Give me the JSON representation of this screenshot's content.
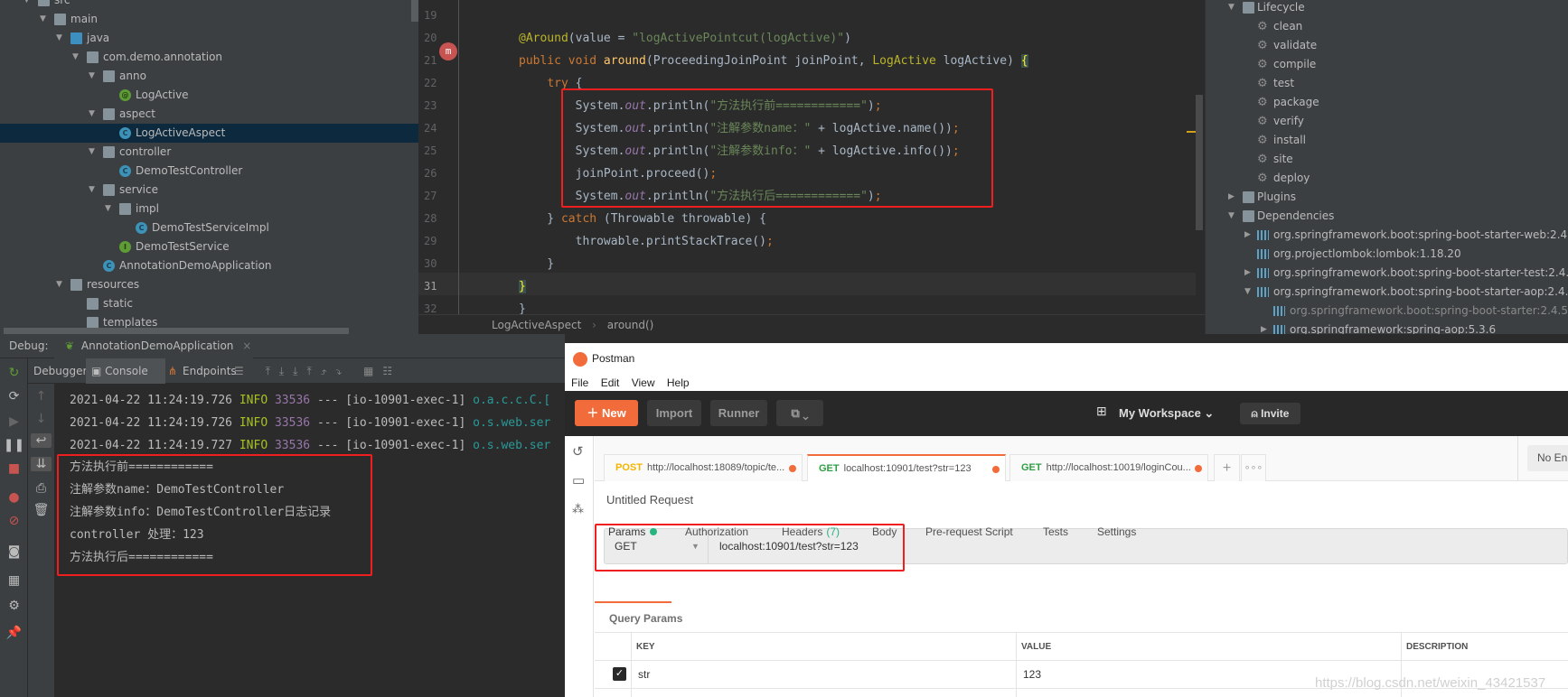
{
  "project_tree": [
    {
      "label": "src",
      "depth": 1,
      "icon": "folder",
      "expanded": true
    },
    {
      "label": "main",
      "depth": 2,
      "icon": "folder",
      "expanded": true
    },
    {
      "label": "java",
      "depth": 3,
      "icon": "source-folder",
      "expanded": true
    },
    {
      "label": "com.demo.annotation",
      "depth": 4,
      "icon": "package",
      "expanded": true
    },
    {
      "label": "anno",
      "depth": 5,
      "icon": "package",
      "expanded": true
    },
    {
      "label": "LogActive",
      "depth": 6,
      "icon": "annotation",
      "glyph": "@"
    },
    {
      "label": "aspect",
      "depth": 5,
      "icon": "package",
      "expanded": true
    },
    {
      "label": "LogActiveAspect",
      "depth": 6,
      "icon": "class",
      "glyph": "C",
      "selected": true
    },
    {
      "label": "controller",
      "depth": 5,
      "icon": "package",
      "expanded": true
    },
    {
      "label": "DemoTestController",
      "depth": 6,
      "icon": "class",
      "glyph": "C"
    },
    {
      "label": "service",
      "depth": 5,
      "icon": "package",
      "expanded": true
    },
    {
      "label": "impl",
      "depth": 6,
      "icon": "package",
      "expanded": true
    },
    {
      "label": "DemoTestServiceImpl",
      "depth": 7,
      "icon": "class",
      "glyph": "C"
    },
    {
      "label": "DemoTestService",
      "depth": 6,
      "icon": "interface",
      "glyph": "I"
    },
    {
      "label": "AnnotationDemoApplication",
      "depth": 5,
      "icon": "spring-boot-class",
      "glyph": "C"
    },
    {
      "label": "resources",
      "depth": 3,
      "icon": "resources-folder",
      "expanded": true
    },
    {
      "label": "static",
      "depth": 4,
      "icon": "folder"
    },
    {
      "label": "templates",
      "depth": 4,
      "icon": "folder"
    }
  ],
  "editor": {
    "first_line": 19,
    "current_line": 31,
    "lines": [
      [],
      [
        {
          "t": "@Around",
          "c": "an"
        },
        {
          "t": "(value = "
        },
        {
          "t": "\"logActivePointcut(logActive)\"",
          "c": "st"
        },
        {
          "t": ")"
        }
      ],
      [
        {
          "t": "public void ",
          "c": "kw"
        },
        {
          "t": "around",
          "c": "mt"
        },
        {
          "t": "(ProceedingJoinPoint joinPoint, "
        },
        {
          "t": "LogActive",
          "c": "tp"
        },
        {
          "t": " logActive) "
        },
        {
          "t": "{",
          "c": "br"
        }
      ],
      [
        {
          "t": "    "
        },
        {
          "t": "try",
          "c": "kw"
        },
        {
          "t": " {"
        }
      ],
      [
        {
          "t": "        System."
        },
        {
          "t": "out",
          "c": "fd"
        },
        {
          "t": ".println("
        },
        {
          "t": "\"方法执行前============\"",
          "c": "st"
        },
        {
          "t": ")"
        },
        {
          "t": ";",
          "c": "kw"
        }
      ],
      [
        {
          "t": "        System."
        },
        {
          "t": "out",
          "c": "fd"
        },
        {
          "t": ".println("
        },
        {
          "t": "\"注解参数name：\"",
          "c": "st"
        },
        {
          "t": " + logActive.name())"
        },
        {
          "t": ";",
          "c": "kw"
        }
      ],
      [
        {
          "t": "        System."
        },
        {
          "t": "out",
          "c": "fd"
        },
        {
          "t": ".println("
        },
        {
          "t": "\"注解参数info：\"",
          "c": "st"
        },
        {
          "t": " + logActive.info())"
        },
        {
          "t": ";",
          "c": "kw"
        }
      ],
      [
        {
          "t": "        joinPoint.proceed()"
        },
        {
          "t": ";",
          "c": "kw"
        }
      ],
      [
        {
          "t": "        System."
        },
        {
          "t": "out",
          "c": "fd"
        },
        {
          "t": ".println("
        },
        {
          "t": "\"方法执行后============\"",
          "c": "st"
        },
        {
          "t": ")"
        },
        {
          "t": ";",
          "c": "kw"
        }
      ],
      [
        {
          "t": "    } "
        },
        {
          "t": "catch",
          "c": "kw"
        },
        {
          "t": " (Throwable throwable) {"
        }
      ],
      [
        {
          "t": "        throwable.printStackTrace()"
        },
        {
          "t": ";",
          "c": "kw"
        }
      ],
      [
        {
          "t": "    }"
        }
      ],
      [
        {
          "t": "}",
          "c": "br"
        }
      ],
      [
        {
          "t": "}"
        }
      ]
    ],
    "breadcrumb": [
      "LogActiveAspect",
      "around()"
    ]
  },
  "maven": [
    {
      "label": "Lifecycle",
      "depth": 0,
      "icon": "lifecycle-folder",
      "expanded": true
    },
    {
      "label": "clean",
      "depth": 1,
      "icon": "gear"
    },
    {
      "label": "validate",
      "depth": 1,
      "icon": "gear"
    },
    {
      "label": "compile",
      "depth": 1,
      "icon": "gear"
    },
    {
      "label": "test",
      "depth": 1,
      "icon": "gear"
    },
    {
      "label": "package",
      "depth": 1,
      "icon": "gear"
    },
    {
      "label": "verify",
      "depth": 1,
      "icon": "gear"
    },
    {
      "label": "install",
      "depth": 1,
      "icon": "gear"
    },
    {
      "label": "site",
      "depth": 1,
      "icon": "gear"
    },
    {
      "label": "deploy",
      "depth": 1,
      "icon": "gear"
    },
    {
      "label": "Plugins",
      "depth": 0,
      "icon": "plugins-folder",
      "expanded": false
    },
    {
      "label": "Dependencies",
      "depth": 0,
      "icon": "dependencies-folder",
      "expanded": true
    },
    {
      "label": "org.springframework.boot:spring-boot-starter-web:2.4.5",
      "depth": 1,
      "icon": "library",
      "expanded": false
    },
    {
      "label": "org.projectlombok:lombok:1.18.20",
      "depth": 1,
      "icon": "library"
    },
    {
      "label": "org.springframework.boot:spring-boot-starter-test:2.4.5",
      "depth": 1,
      "icon": "library",
      "expanded": false
    },
    {
      "label": "org.springframework.boot:spring-boot-starter-aop:2.4.5",
      "depth": 1,
      "icon": "library",
      "expanded": true
    },
    {
      "label": "org.springframework.boot:spring-boot-starter:2.4.5 (",
      "depth": 2,
      "icon": "library",
      "dim": true
    },
    {
      "label": "org.springframework:spring-aop:5.3.6",
      "depth": 2,
      "icon": "library",
      "expanded": false
    }
  ],
  "debug": {
    "label": "Debug:",
    "run_config": "AnnotationDemoApplication",
    "tabs": [
      "Debugger",
      "Console",
      "Endpoints"
    ],
    "log_lines": [
      {
        "date": "2021-04-22 11:24:19.726",
        "level": "INFO",
        "pid": "33536",
        "sep": "---",
        "thread": "[io-10901-exec-1]",
        "logger": "o.a.c.c.C.["
      },
      {
        "date": "2021-04-22 11:24:19.726",
        "level": "INFO",
        "pid": "33536",
        "sep": "---",
        "thread": "[io-10901-exec-1]",
        "logger": "o.s.web.ser"
      },
      {
        "date": "2021-04-22 11:24:19.727",
        "level": "INFO",
        "pid": "33536",
        "sep": "---",
        "thread": "[io-10901-exec-1]",
        "logger": "o.s.web.ser"
      }
    ],
    "output": [
      "方法执行前============",
      "注解参数name：DemoTestController",
      "注解参数info：DemoTestController日志记录",
      "controller 处理：123",
      "方法执行后============"
    ]
  },
  "postman": {
    "title": "Postman",
    "menu": [
      "File",
      "Edit",
      "View",
      "Help"
    ],
    "new_label": "New",
    "import_label": "Import",
    "runner_label": "Runner",
    "workspace": "My Workspace",
    "invite": "Invite",
    "tabs": [
      {
        "method": "POST",
        "url": "http://localhost:18089/topic/te...",
        "method_color": "#f4b400"
      },
      {
        "method": "GET",
        "url": "localhost:10901/test?str=123",
        "method_color": "#2f9e44",
        "active": true
      },
      {
        "method": "GET",
        "url": "http://localhost:10019/loginCou...",
        "method_color": "#2f9e44"
      }
    ],
    "environment": "No En",
    "request_name": "Untitled Request",
    "method": "GET",
    "url": "localhost:10901/test?str=123",
    "request_tabs": [
      "Params",
      "Authorization",
      "Headers",
      "Body",
      "Pre-request Script",
      "Tests",
      "Settings"
    ],
    "headers_count": "(7)",
    "query_params_label": "Query Params",
    "columns": [
      "KEY",
      "VALUE",
      "DESCRIPTION"
    ],
    "params": [
      {
        "checked": true,
        "key": "str",
        "value": "123",
        "description": ""
      }
    ],
    "watermark": "https://blog.csdn.net/weixin_43421537",
    "accent": "#f26b3a"
  }
}
